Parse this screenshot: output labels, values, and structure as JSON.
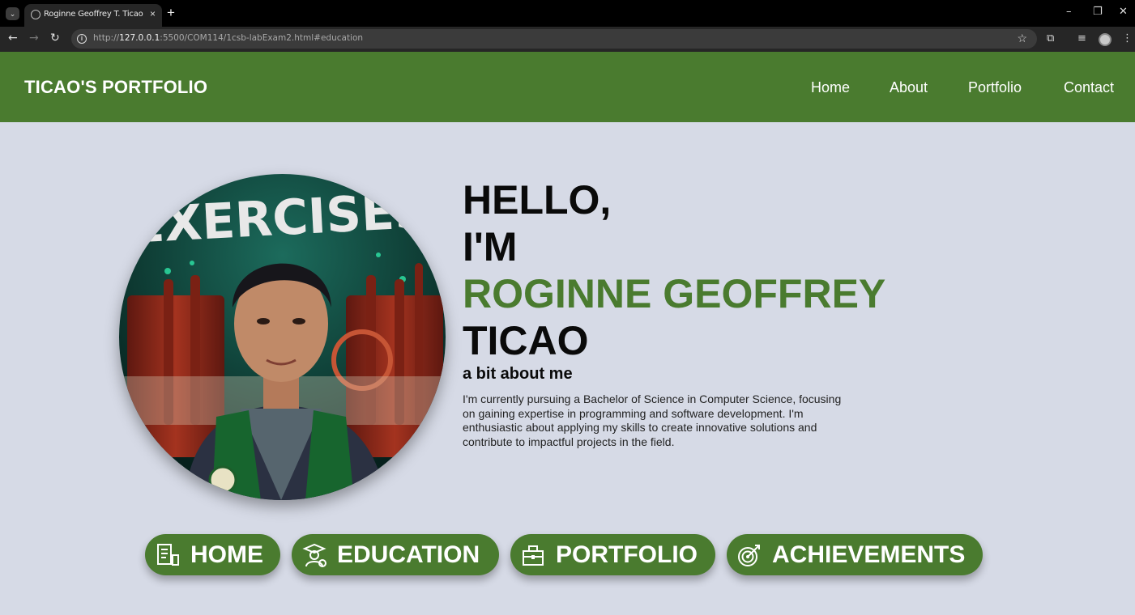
{
  "browser": {
    "tab_title": "Roginne Geoffrey T. Ticao",
    "tab_close": "×",
    "new_tab": "+",
    "url_prefix": "http://",
    "url_host": "127.0.0.1",
    "url_rest": ":5500/COM114/1csb-labExam2.html#education",
    "window_controls": [
      "–",
      "❐",
      "✕"
    ]
  },
  "header": {
    "brand": "TICAO'S PORTFOLIO",
    "nav": [
      "Home",
      "About",
      "Portfolio",
      "Contact"
    ]
  },
  "hero": {
    "line1": "HELLO,",
    "line2": "I'M",
    "name_first": "ROGINNE GEOFFREY",
    "name_last": "TICAO",
    "subtitle": "a bit about me",
    "bio": "I'm currently pursuing a Bachelor of Science in Computer Science, focusing on gaining expertise in programming and software development. I'm enthusiastic about applying my skills to create innovative solutions and contribute to impactful projects in the field.",
    "photo_banner_text": "EXERCISES"
  },
  "sections": [
    {
      "label": "HOME",
      "icon": "resume-icon"
    },
    {
      "label": "EDUCATION",
      "icon": "graduate-icon"
    },
    {
      "label": "PORTFOLIO",
      "icon": "briefcase-icon"
    },
    {
      "label": "ACHIEVEMENTS",
      "icon": "target-icon"
    }
  ],
  "colors": {
    "accent": "#4a7b2f",
    "background": "#d6dae6",
    "text": "#0a0a0a"
  }
}
